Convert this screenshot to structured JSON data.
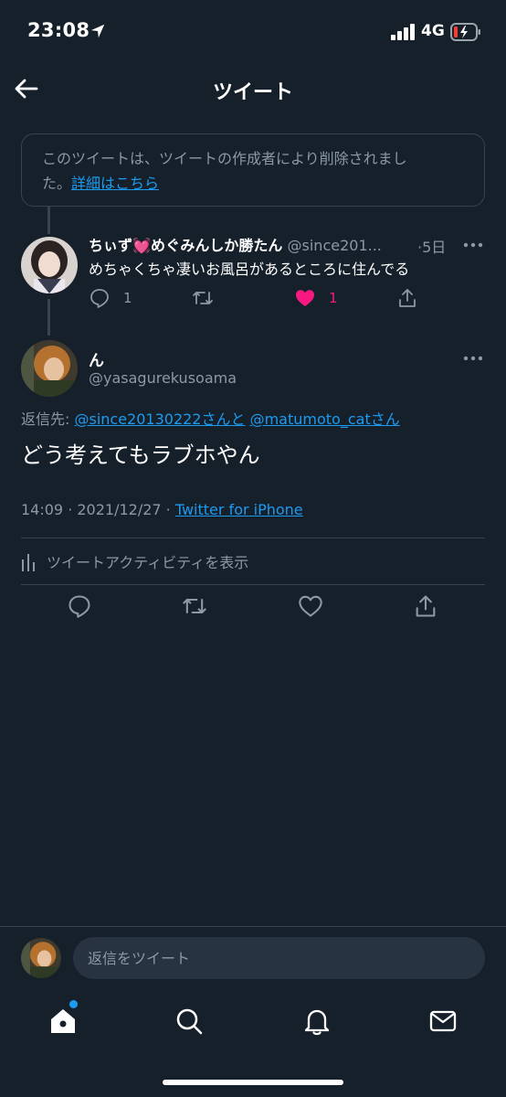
{
  "status_bar": {
    "time": "23:08",
    "network": "4G"
  },
  "header": {
    "title": "ツイート"
  },
  "deleted_notice": {
    "line1": "このツイートは、ツイートの作成者により削除されまし",
    "line2_prefix": "た。",
    "link": "詳細はこちら"
  },
  "parent_tweet": {
    "name_part1": "ちぃず",
    "emoji": "💓",
    "name_part2": "めぐみんしか勝たん",
    "handle": "@since201...",
    "time": "·5日",
    "text": "めちゃくちゃ凄いお風呂があるところに住んでる",
    "reply_count": "1",
    "like_count": "1"
  },
  "main_tweet": {
    "name": "ん",
    "handle": "@yasagurekusoama",
    "replying_label": "返信先: ",
    "reply_to_1": "@since20130222",
    "san_1": "さんと",
    "reply_to_2": "@matumoto_cat",
    "san_2": "さん",
    "text": "どう考えてもラブホやん",
    "time": "14:09 · 2021/12/27 · ",
    "source": "Twitter for iPhone",
    "activity": "ツイートアクティビティを表示"
  },
  "reply_bar": {
    "placeholder": "返信をツイート"
  },
  "colors": {
    "background": "#15202b",
    "accent": "#1d9bf0",
    "like": "#f91880",
    "secondary_text": "#8b98a5",
    "border": "#38444d"
  },
  "icons": {
    "back": "arrow-left-icon",
    "more": "more-dots-icon",
    "reply": "reply-icon",
    "retweet": "retweet-icon",
    "like": "heart-icon",
    "share": "share-icon",
    "activity": "bar-chart-icon",
    "home": "home-icon",
    "search": "search-icon",
    "notifications": "bell-icon",
    "messages": "mail-icon"
  }
}
